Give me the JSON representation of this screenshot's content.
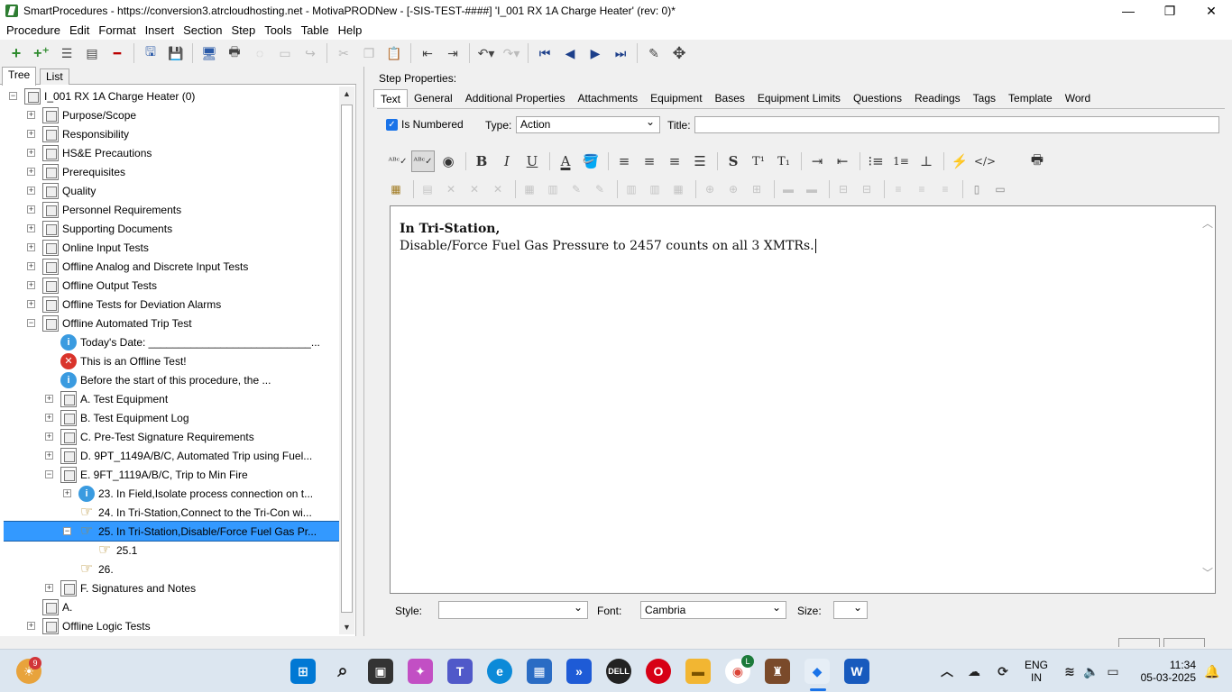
{
  "window": {
    "title": "SmartProcedures - https://conversion3.atrcloudhosting.net - MotivaPRODNew - [-SIS-TEST-####] 'I_001 RX 1A Charge Heater' (rev: 0)*",
    "minimize": "—",
    "maximize": "❐",
    "close": "✕"
  },
  "menu": {
    "items": [
      "Procedure",
      "Edit",
      "Format",
      "Insert",
      "Section",
      "Step",
      "Tools",
      "Table",
      "Help"
    ],
    "accel": [
      "P",
      "E",
      "F",
      "I",
      "S",
      "S",
      "T",
      "T",
      "H"
    ]
  },
  "left_panel": {
    "tabs": [
      "Tree",
      "List"
    ],
    "active_tab": "Tree",
    "tree": [
      {
        "label": "I_001 RX 1A Charge Heater (0)",
        "indent": 0,
        "expander": "minus",
        "icon": "doc"
      },
      {
        "label": "Purpose/Scope",
        "indent": 1,
        "expander": "plus",
        "icon": "doc"
      },
      {
        "label": "Responsibility",
        "indent": 1,
        "expander": "plus",
        "icon": "doc"
      },
      {
        "label": "HS&E Precautions",
        "indent": 1,
        "expander": "plus",
        "icon": "doc"
      },
      {
        "label": "Prerequisites",
        "indent": 1,
        "expander": "plus",
        "icon": "doc"
      },
      {
        "label": "Quality",
        "indent": 1,
        "expander": "plus",
        "icon": "doc"
      },
      {
        "label": "Personnel Requirements",
        "indent": 1,
        "expander": "plus",
        "icon": "doc"
      },
      {
        "label": "Supporting Documents",
        "indent": 1,
        "expander": "plus",
        "icon": "doc"
      },
      {
        "label": "Online Input Tests",
        "indent": 1,
        "expander": "plus",
        "icon": "doc"
      },
      {
        "label": "Offline Analog and Discrete Input Tests",
        "indent": 1,
        "expander": "plus",
        "icon": "doc"
      },
      {
        "label": "Offline Output Tests",
        "indent": 1,
        "expander": "plus",
        "icon": "doc"
      },
      {
        "label": "Offline Tests for Deviation Alarms",
        "indent": 1,
        "expander": "plus",
        "icon": "doc"
      },
      {
        "label": "Offline Automated Trip Test",
        "indent": 1,
        "expander": "minus",
        "icon": "doc"
      },
      {
        "label": "Today's Date: ___________________________...",
        "indent": 2,
        "expander": "none",
        "icon": "info"
      },
      {
        "label": "This is an Offline Test!",
        "indent": 2,
        "expander": "none",
        "icon": "error"
      },
      {
        "label": "Before the start of this procedure, the ...",
        "indent": 2,
        "expander": "none",
        "icon": "info"
      },
      {
        "label": "A. Test Equipment",
        "indent": 2,
        "expander": "plus",
        "icon": "doc"
      },
      {
        "label": "B. Test Equipment Log",
        "indent": 2,
        "expander": "plus",
        "icon": "doc"
      },
      {
        "label": "C. Pre-Test Signature Requirements",
        "indent": 2,
        "expander": "plus",
        "icon": "doc"
      },
      {
        "label": "D. 9PT_1149A/B/C, Automated Trip using Fuel...",
        "indent": 2,
        "expander": "plus",
        "icon": "doc"
      },
      {
        "label": "E. 9FT_1119A/B/C, Trip to Min Fire",
        "indent": 2,
        "expander": "minus",
        "icon": "doc"
      },
      {
        "label": "23. In Field,Isolate process connection on t...",
        "indent": 3,
        "expander": "plus",
        "icon": "info"
      },
      {
        "label": "24. In Tri-Station,Connect to the Tri-Con wi...",
        "indent": 3,
        "expander": "none",
        "icon": "hand"
      },
      {
        "label": "25. In Tri-Station,Disable/Force Fuel Gas Pr...",
        "indent": 3,
        "expander": "minus",
        "icon": "hand",
        "selected": true
      },
      {
        "label": "25.1",
        "indent": 4,
        "expander": "none",
        "icon": "hand"
      },
      {
        "label": "26.",
        "indent": 3,
        "expander": "none",
        "icon": "hand"
      },
      {
        "label": "F. Signatures and Notes",
        "indent": 2,
        "expander": "plus",
        "icon": "doc"
      },
      {
        "label": "A.",
        "indent": 1,
        "expander": "none",
        "icon": "doc"
      },
      {
        "label": "Offline Logic Tests",
        "indent": 1,
        "expander": "plus",
        "icon": "doc"
      }
    ]
  },
  "right_panel": {
    "step_properties_label": "Step Properties:",
    "tabs": [
      "Text",
      "General",
      "Additional Properties",
      "Attachments",
      "Equipment",
      "Bases",
      "Equipment Limits",
      "Questions",
      "Readings",
      "Tags",
      "Template",
      "Word"
    ],
    "active_tab": "Text",
    "is_numbered_label": "Is Numbered",
    "is_numbered_check": "✓",
    "type_label": "Type:",
    "type_value": "Action",
    "title_label": "Title:",
    "title_value": "",
    "editor": {
      "line1": "In Tri-Station,",
      "line2": "Disable/Force Fuel Gas Pressure to 2457 counts on all 3 XMTRs."
    },
    "style_label": "Style:",
    "style_value": "",
    "font_label": "Font:",
    "font_value": "Cambria",
    "size_label": "Size:",
    "size_value": ""
  },
  "format_toolbar": {
    "bold": "B",
    "italic": "I",
    "underline": "U",
    "font_color": "A",
    "strike": "S",
    "superscript": "T¹",
    "subscript": "T₁",
    "code": "</>"
  },
  "taskbar": {
    "notification_badge": "9",
    "language": "ENG",
    "region": "IN",
    "time": "11:34",
    "date": "05-03-2025",
    "chrome_badge": "L"
  },
  "colors": {
    "selection": "#3399ff",
    "accent": "#1a73e8",
    "taskbar": "#dce6f0"
  }
}
